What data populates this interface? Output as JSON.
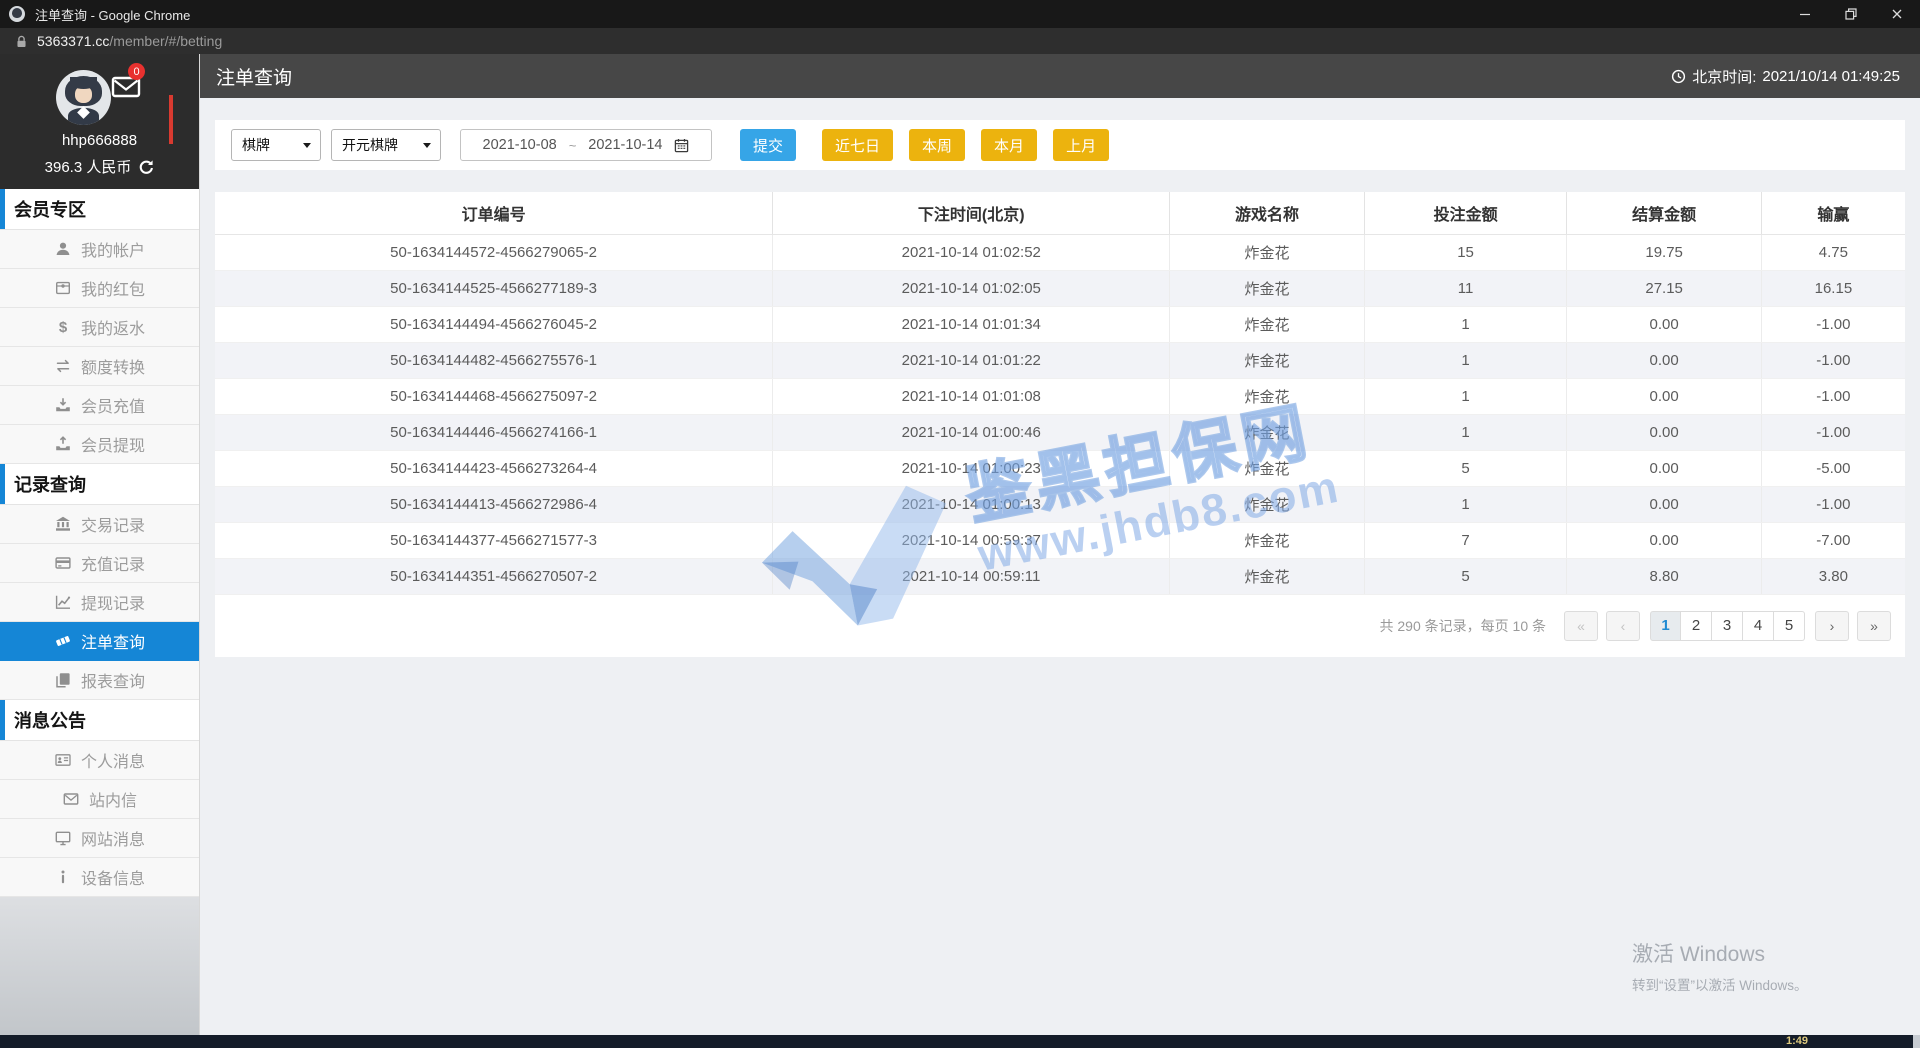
{
  "window": {
    "title": "注单查询 - Google Chrome",
    "url": {
      "domain": "5363371.cc",
      "path": "/member/#/betting"
    }
  },
  "page_header": {
    "title": "注单查询",
    "clock_prefix": "北京时间:",
    "clock_time": "2021/10/14 01:49:25"
  },
  "profile": {
    "username": "hhp666888",
    "balance": "396.3 人民币",
    "mail_badge": "0"
  },
  "sidebar": {
    "sections": [
      {
        "id": "member-zone",
        "header": "会员专区",
        "items": [
          {
            "id": "my-account",
            "icon": "user-icon",
            "label": "我的帐户"
          },
          {
            "id": "red-packet",
            "icon": "red-packet-icon",
            "label": "我的红包"
          },
          {
            "id": "my-rebate",
            "icon": "dollar-icon",
            "label": "我的返水"
          },
          {
            "id": "quota-transfer",
            "icon": "exchange-icon",
            "label": "额度转换"
          },
          {
            "id": "member-deposit",
            "icon": "deposit-icon",
            "label": "会员充值"
          },
          {
            "id": "member-withdraw",
            "icon": "withdraw-icon",
            "label": "会员提现"
          }
        ]
      },
      {
        "id": "record-query",
        "header": "记录查询",
        "items": [
          {
            "id": "transaction-records",
            "icon": "bank-icon",
            "label": "交易记录"
          },
          {
            "id": "deposit-records",
            "icon": "card-icon",
            "label": "充值记录"
          },
          {
            "id": "withdrawal-records",
            "icon": "chart-icon",
            "label": "提现记录"
          },
          {
            "id": "bet-query",
            "icon": "ticket-icon",
            "label": "注单查询",
            "active": true
          },
          {
            "id": "report-query",
            "icon": "report-icon",
            "label": "报表查询"
          }
        ]
      },
      {
        "id": "messages",
        "header": "消息公告",
        "items": [
          {
            "id": "personal-messages",
            "icon": "idcard-icon",
            "label": "个人消息"
          },
          {
            "id": "site-mail",
            "icon": "mail-icon",
            "label": "站内信"
          },
          {
            "id": "site-messages",
            "icon": "monitor-icon",
            "label": "网站消息"
          },
          {
            "id": "device-info",
            "icon": "info-icon",
            "label": "设备信息"
          }
        ]
      }
    ]
  },
  "filters": {
    "category_select": "棋牌",
    "platform_select": "开元棋牌",
    "date_from": "2021-10-08",
    "date_separator": "~",
    "date_to": "2021-10-14",
    "submit_label": "提交",
    "quick_buttons": [
      "近七日",
      "本周",
      "本月",
      "上月"
    ]
  },
  "table": {
    "columns": [
      "订单编号",
      "下注时间(北京)",
      "游戏名称",
      "投注金额",
      "结算金额",
      "输赢"
    ],
    "rows": [
      [
        "50-1634144572-4566279065-2",
        "2021-10-14 01:02:52",
        "炸金花",
        "15",
        "19.75",
        "4.75"
      ],
      [
        "50-1634144525-4566277189-3",
        "2021-10-14 01:02:05",
        "炸金花",
        "11",
        "27.15",
        "16.15"
      ],
      [
        "50-1634144494-4566276045-2",
        "2021-10-14 01:01:34",
        "炸金花",
        "1",
        "0.00",
        "-1.00"
      ],
      [
        "50-1634144482-4566275576-1",
        "2021-10-14 01:01:22",
        "炸金花",
        "1",
        "0.00",
        "-1.00"
      ],
      [
        "50-1634144468-4566275097-2",
        "2021-10-14 01:01:08",
        "炸金花",
        "1",
        "0.00",
        "-1.00"
      ],
      [
        "50-1634144446-4566274166-1",
        "2021-10-14 01:00:46",
        "炸金花",
        "1",
        "0.00",
        "-1.00"
      ],
      [
        "50-1634144423-4566273264-4",
        "2021-10-14 01:00:23",
        "炸金花",
        "5",
        "0.00",
        "-5.00"
      ],
      [
        "50-1634144413-4566272986-4",
        "2021-10-14 01:00:13",
        "炸金花",
        "1",
        "0.00",
        "-1.00"
      ],
      [
        "50-1634144377-4566271577-3",
        "2021-10-14 00:59:37",
        "炸金花",
        "7",
        "0.00",
        "-7.00"
      ],
      [
        "50-1634144351-4566270507-2",
        "2021-10-14 00:59:11",
        "炸金花",
        "5",
        "8.80",
        "3.80"
      ]
    ]
  },
  "pagination": {
    "summary": "共 290 条记录，每页 10 条",
    "first_label": "«",
    "prev_label": "‹",
    "pages": [
      "1",
      "2",
      "3",
      "4",
      "5"
    ],
    "active_page": "1",
    "next_label": "›",
    "last_label": "»"
  },
  "watermark": {
    "brand": "鉴黑担保网",
    "site": "www.jhdb8.com"
  },
  "activation": {
    "line1": "激活 Windows",
    "line2": "转到“设置”以激活 Windows。"
  },
  "player_bar": {
    "time": "1:49"
  },
  "colors": {
    "accent_blue": "#1586d6",
    "button_blue": "#36a5e7",
    "button_yellow": "#ecb30e",
    "badge_red": "#e8312f"
  }
}
